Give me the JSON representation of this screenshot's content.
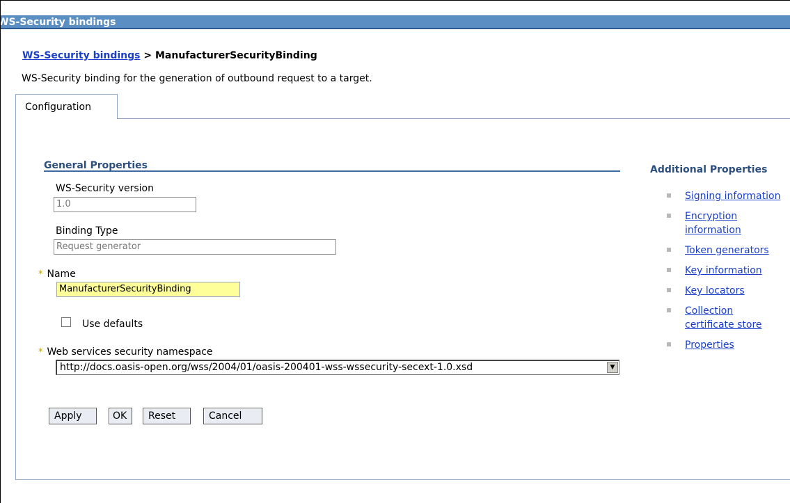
{
  "window": {
    "title": "WS-Security bindings"
  },
  "breadcrumb": {
    "link": "WS-Security bindings",
    "separator": " > ",
    "current": "ManufacturerSecurityBinding"
  },
  "description": "WS-Security binding for the generation of outbound request to a target.",
  "tabs": [
    {
      "label": "Configuration",
      "selected": true
    }
  ],
  "general": {
    "title": "General Properties",
    "version": {
      "label": "WS-Security version",
      "value": "1.0"
    },
    "binding_type": {
      "label": "Binding Type",
      "value": "Request generator"
    },
    "name": {
      "label": "Name",
      "value": "ManufacturerSecurityBinding",
      "required": true
    },
    "use_defaults": {
      "label": "Use defaults",
      "checked": false
    },
    "namespace": {
      "label": "Web services security namespace",
      "value": "http://docs.oasis-open.org/wss/2004/01/oasis-200401-wss-wssecurity-secext-1.0.xsd",
      "required": true
    }
  },
  "buttons": {
    "apply": "Apply",
    "ok": "OK",
    "reset": "Reset",
    "cancel": "Cancel"
  },
  "additional": {
    "title": "Additional Properties",
    "links": [
      "Signing information",
      "Encryption information",
      "Token generators",
      "Key information",
      "Key locators",
      "Collection certificate store",
      "Properties"
    ]
  },
  "required_marker": "*"
}
